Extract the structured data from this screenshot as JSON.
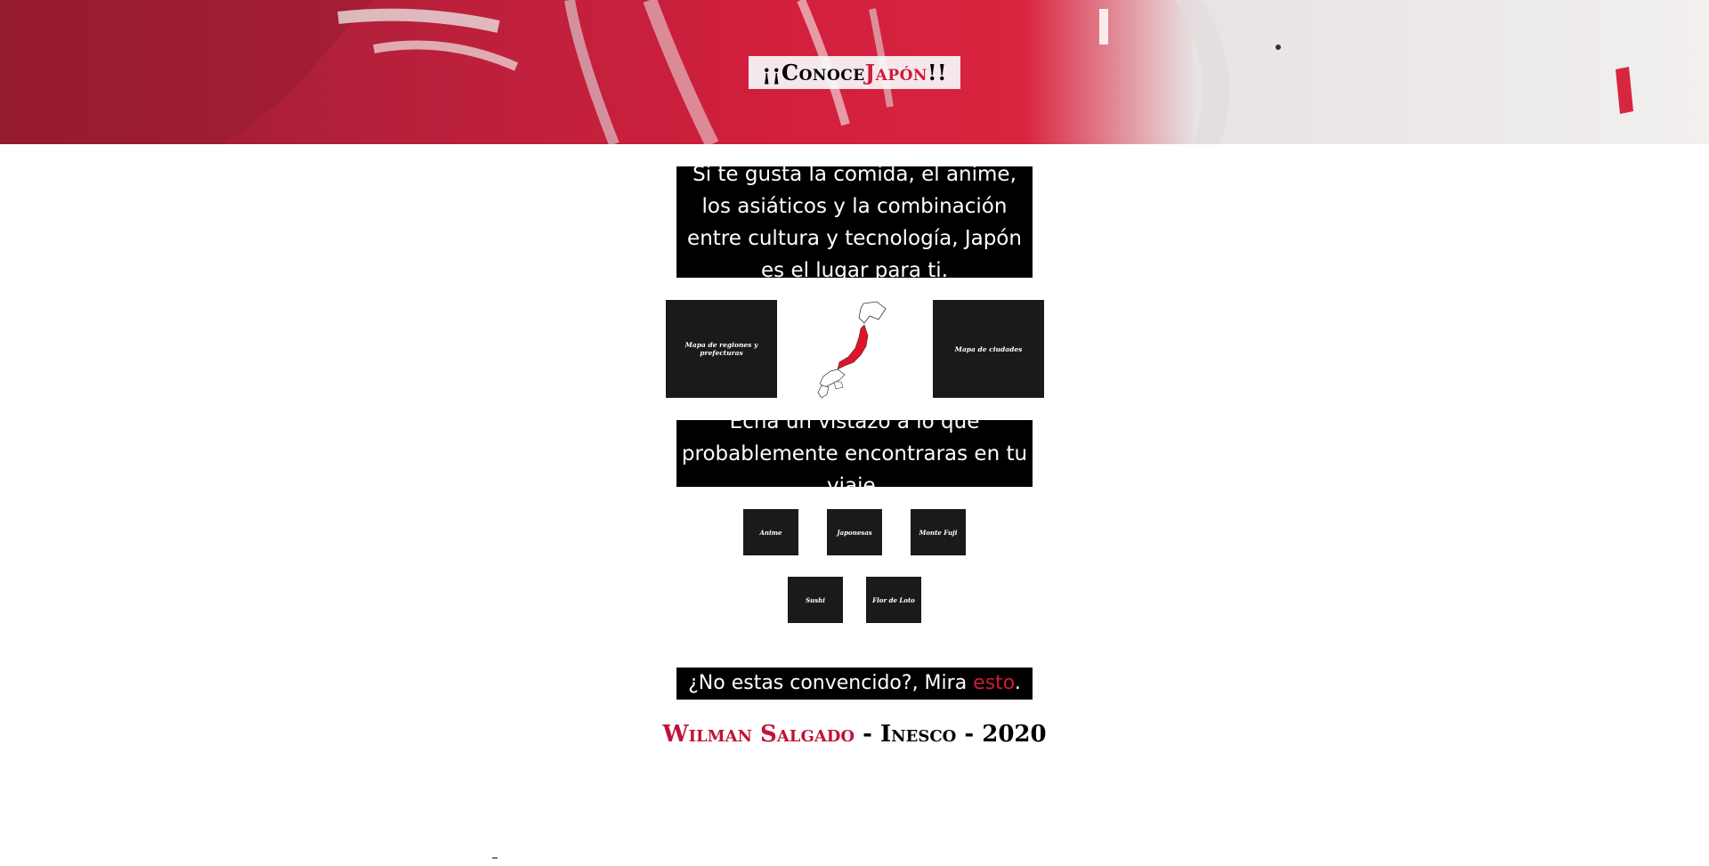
{
  "hero": {
    "title_prefix": "¡¡Conoce ",
    "title_accent": "Japón",
    "title_suffix": "!!"
  },
  "intro": {
    "text": "Si te gusta la comida, el anime, los asiáticos y la combinación entre cultura y tecnología, Japón es el lugar para ti."
  },
  "maps": {
    "regions_button": "Mapa de regiones y prefecturas",
    "cities_button": "Mapa de ciudades"
  },
  "look": {
    "text": "Echa un vistazo a lo que probablemente encontraras en tu viaje."
  },
  "gallery": {
    "items": [
      "Anime",
      "Japonesas",
      "Monte Fuji",
      "Sushi",
      "Flor de Loto"
    ]
  },
  "convinced": {
    "prefix": "¿No estas convencido?, Mira ",
    "link": "esto",
    "suffix": "."
  },
  "footer": {
    "name": "Wilman Salgado",
    "rest": " - Inesco - 2020"
  },
  "colors": {
    "accent": "#d01a3a",
    "button_bg": "#1a1a1a"
  }
}
